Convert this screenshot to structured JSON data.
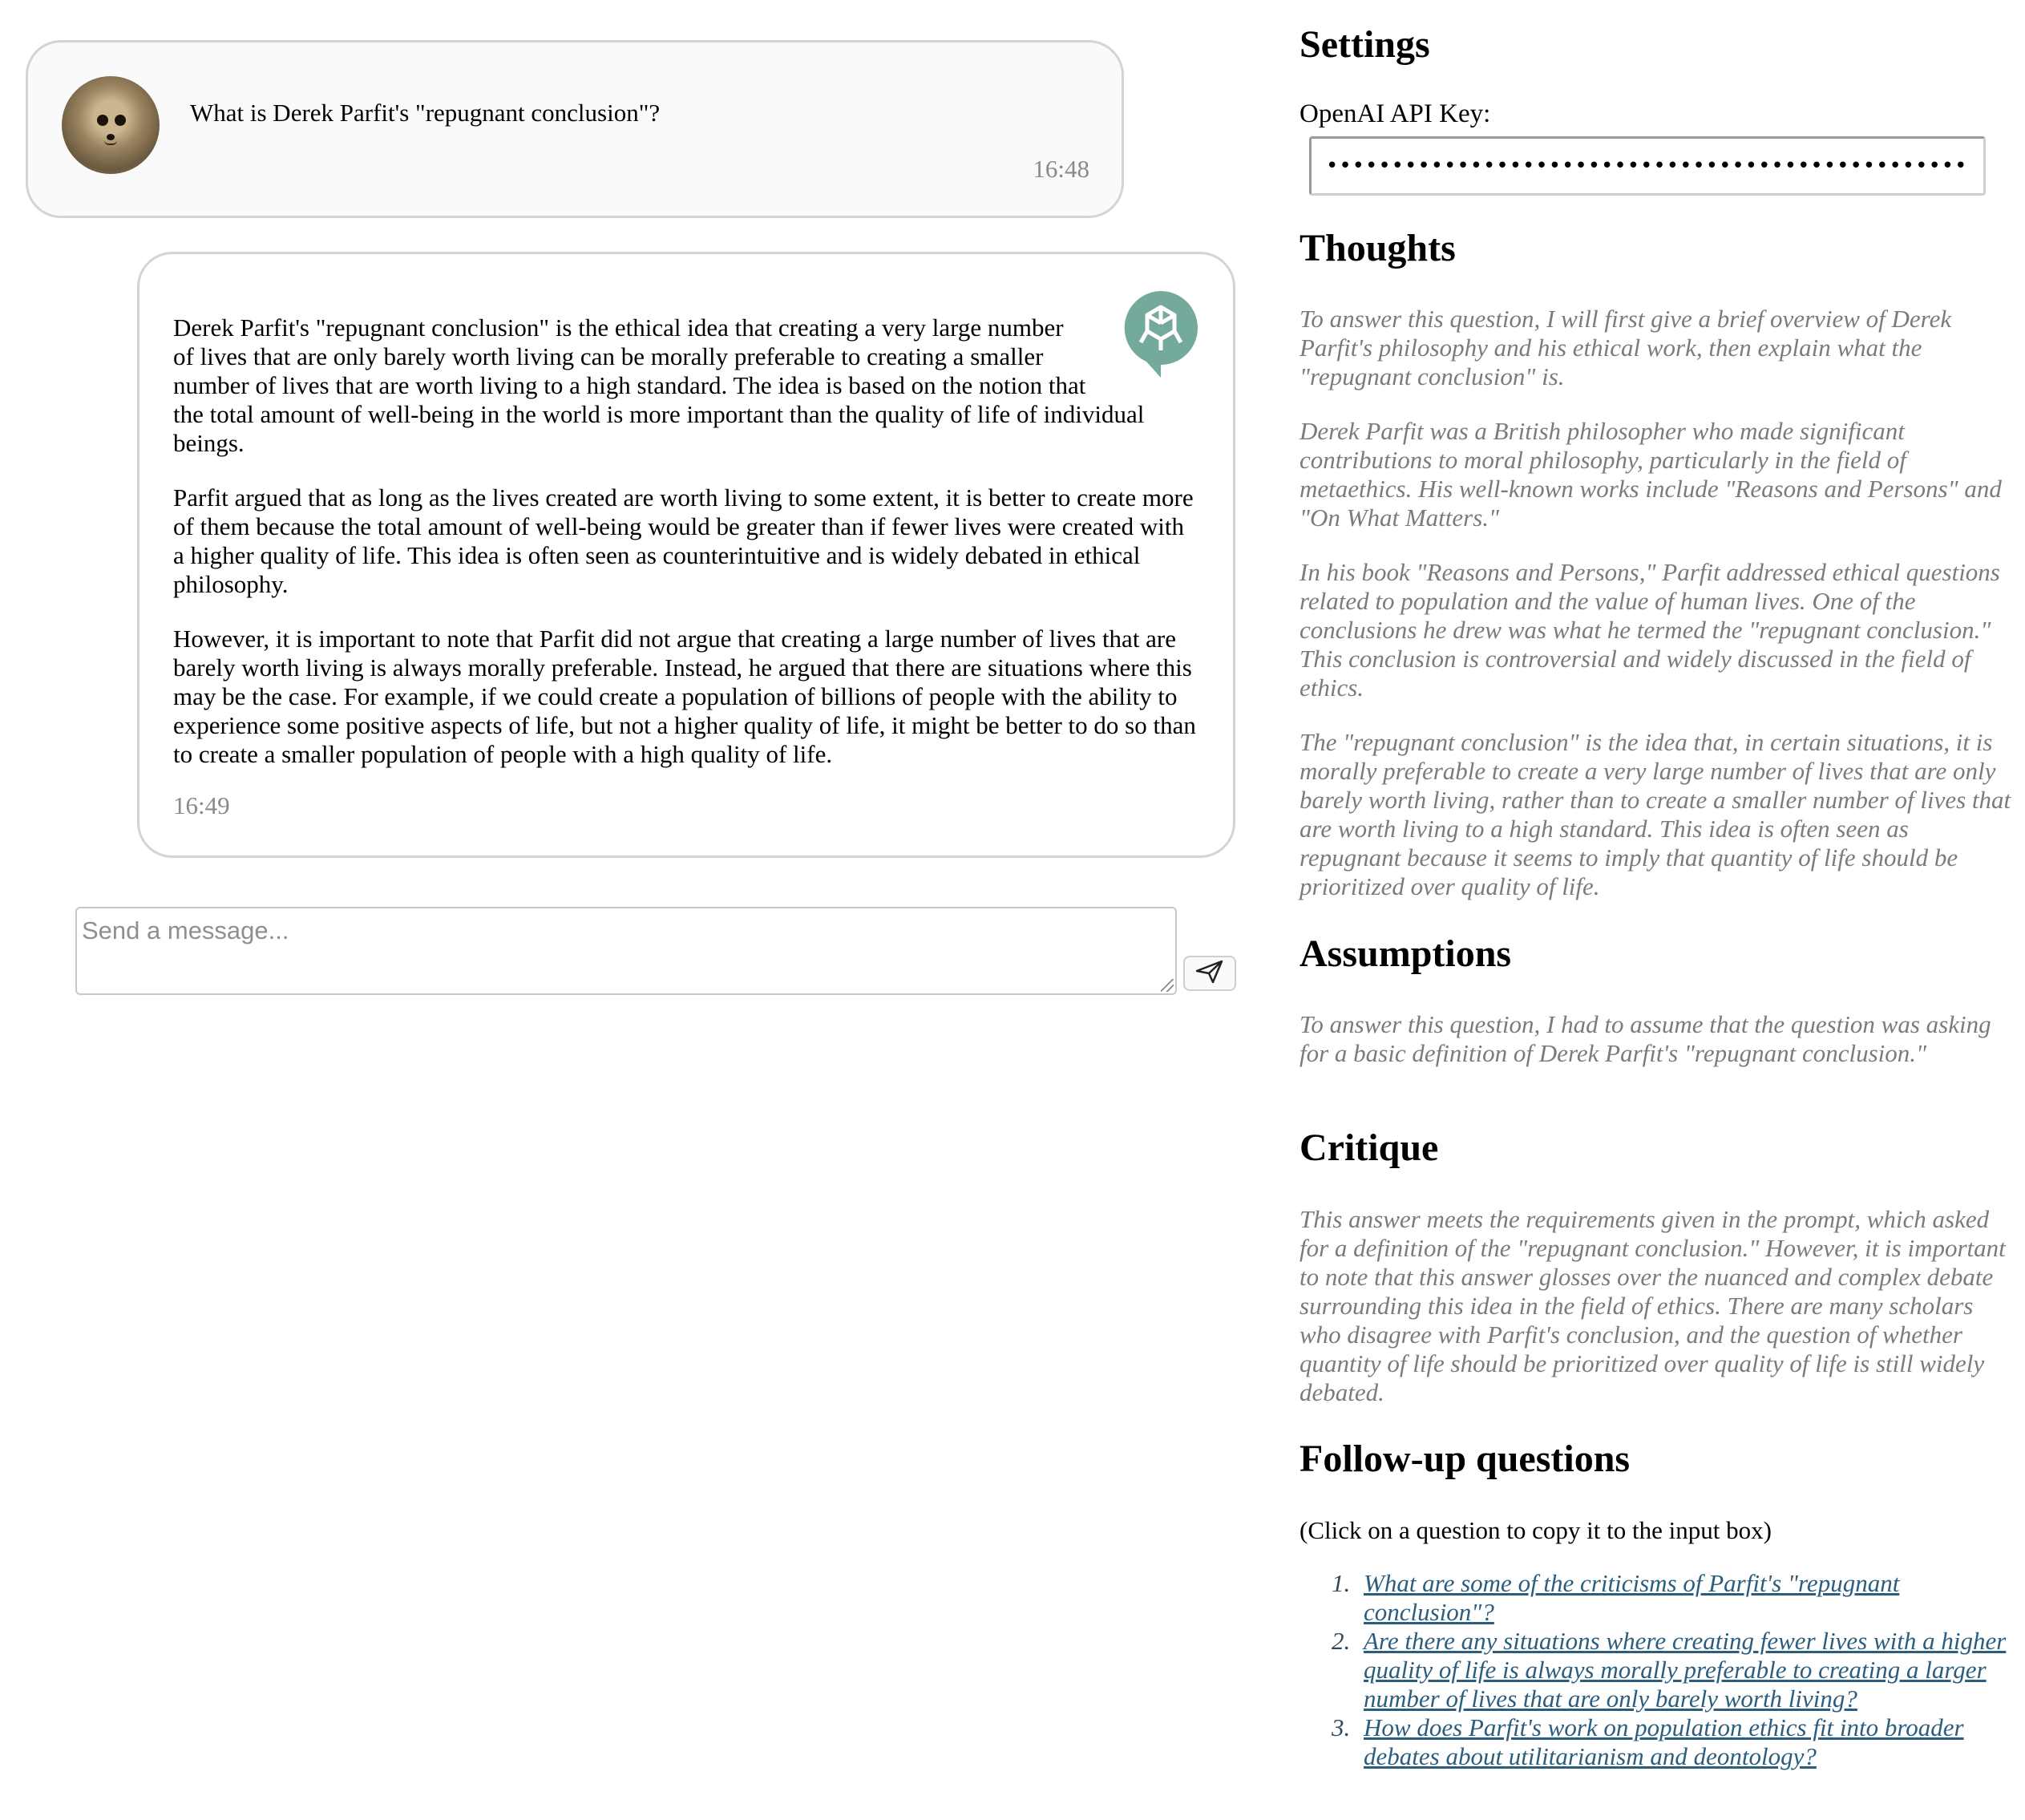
{
  "chat": {
    "user_message": {
      "text": "What is Derek Parfit's \"repugnant conclusion\"?",
      "time": "16:48"
    },
    "assistant_message": {
      "paragraphs": [
        "Derek Parfit's \"repugnant conclusion\" is the ethical idea that creating a very large number of lives that are only barely worth living can be morally preferable to creating a smaller number of lives that are worth living to a high standard. The idea is based on the notion that the total amount of well-being in the world is more important than the quality of life of individual beings.",
        "Parfit argued that as long as the lives created are worth living to some extent, it is better to create more of them because the total amount of well-being would be greater than if fewer lives were created with a higher quality of life. This idea is often seen as counterintuitive and is widely debated in ethical philosophy.",
        "However, it is important to note that Parfit did not argue that creating a large number of lives that are barely worth living is always morally preferable. Instead, he argued that there are situations where this may be the case. For example, if we could create a population of billions of people with the ability to experience some positive aspects of life, but not a higher quality of life, it might be better to do so than to create a smaller population of people with a high quality of life."
      ],
      "time": "16:49"
    },
    "composer": {
      "placeholder": "Send a message..."
    }
  },
  "sidebar": {
    "settings_title": "Settings",
    "api_key_label": "OpenAI API Key:",
    "api_key_value": "••••••••••••••••••••••••••••••••••••••••••••••••••••",
    "thoughts_title": "Thoughts",
    "thoughts": [
      "To answer this question, I will first give a brief overview of Derek Parfit's philosophy and his ethical work, then explain what the \"repugnant conclusion\" is.",
      "Derek Parfit was a British philosopher who made significant contributions to moral philosophy, particularly in the field of metaethics. His well-known works include \"Reasons and Persons\" and \"On What Matters.\"",
      "In his book \"Reasons and Persons,\" Parfit addressed ethical questions related to population and the value of human lives. One of the conclusions he drew was what he termed the \"repugnant conclusion.\" This conclusion is controversial and widely discussed in the field of ethics.",
      "The \"repugnant conclusion\" is the idea that, in certain situations, it is morally preferable to create a very large number of lives that are only barely worth living, rather than to create a smaller number of lives that are worth living to a high standard. This idea is often seen as repugnant because it seems to imply that quantity of life should be prioritized over quality of life."
    ],
    "assumptions_title": "Assumptions",
    "assumptions": "To answer this question, I had to assume that the question was asking for a basic definition of Derek Parfit's \"repugnant conclusion.\"",
    "critique_title": "Critique",
    "critique": "This answer meets the requirements given in the prompt, which asked for a definition of the \"repugnant conclusion.\" However, it is important to note that this answer glosses over the nuanced and complex debate surrounding this idea in the field of ethics. There are many scholars who disagree with Parfit's conclusion, and the question of whether quantity of life should be prioritized over quality of life is still widely debated.",
    "followup_title": "Follow-up questions",
    "followup_hint": "(Click on a question to copy it to the input box)",
    "followups": [
      {
        "num": "1.",
        "text": "What are some of the criticisms of Parfit's \"repugnant conclusion\"?"
      },
      {
        "num": "2.",
        "text": "Are there any situations where creating fewer lives with a higher quality of life is always morally preferable to creating a larger number of lives that are only barely worth living?"
      },
      {
        "num": "3.",
        "text": "How does Parfit's work on population ethics fit into broader debates about utilitarianism and deontology?"
      }
    ]
  },
  "icons": {
    "avatar": "meerkat-avatar-icon",
    "assistant": "openai-logo-icon",
    "send": "paper-plane-send-icon"
  },
  "colors": {
    "assistant_logo": "#74aa9c",
    "muted_text": "#7b7b7b",
    "link": "#2b5d7e"
  }
}
